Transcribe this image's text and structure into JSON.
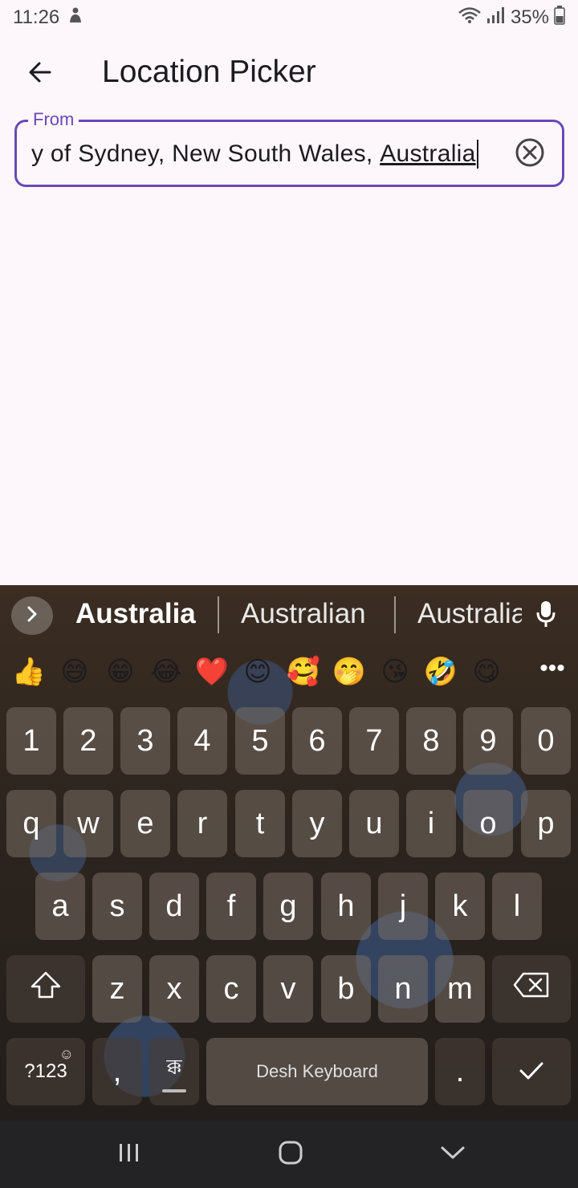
{
  "status_bar": {
    "time": "11:26",
    "battery": "35%",
    "icons": [
      "notification-icon",
      "wifi-icon",
      "signal-icon",
      "battery-icon"
    ]
  },
  "app_bar": {
    "title": "Location Picker",
    "back_icon": "arrow-left-icon"
  },
  "location_field": {
    "label": "From",
    "value_prefix": "y of Sydney, New South Wales, ",
    "value_composing": "Australia",
    "clear_icon": "close-circle-icon"
  },
  "keyboard": {
    "suggestions": [
      "Australia",
      "Australian",
      "Australia"
    ],
    "emojis": [
      "👍",
      "😅",
      "😁",
      "😂",
      "❤️",
      "😊",
      "🥰",
      "🤭",
      "😘",
      "🤣",
      "😋"
    ],
    "more_label": "•••",
    "rows": {
      "numbers": [
        "1",
        "2",
        "3",
        "4",
        "5",
        "6",
        "7",
        "8",
        "9",
        "0"
      ],
      "row1": [
        "q",
        "w",
        "e",
        "r",
        "t",
        "y",
        "u",
        "i",
        "o",
        "p"
      ],
      "row2": [
        "a",
        "s",
        "d",
        "f",
        "g",
        "h",
        "j",
        "k",
        "l"
      ],
      "row3": [
        "z",
        "x",
        "c",
        "v",
        "b",
        "n",
        "m"
      ]
    },
    "symbols_key": "?123",
    "comma_key": ",",
    "language_key": "ক্ক",
    "space_label": "Desh Keyboard",
    "period_key": "."
  },
  "colors": {
    "accent": "#6a48b5",
    "background": "#fdf7fc",
    "nav_bar": "#232325"
  }
}
